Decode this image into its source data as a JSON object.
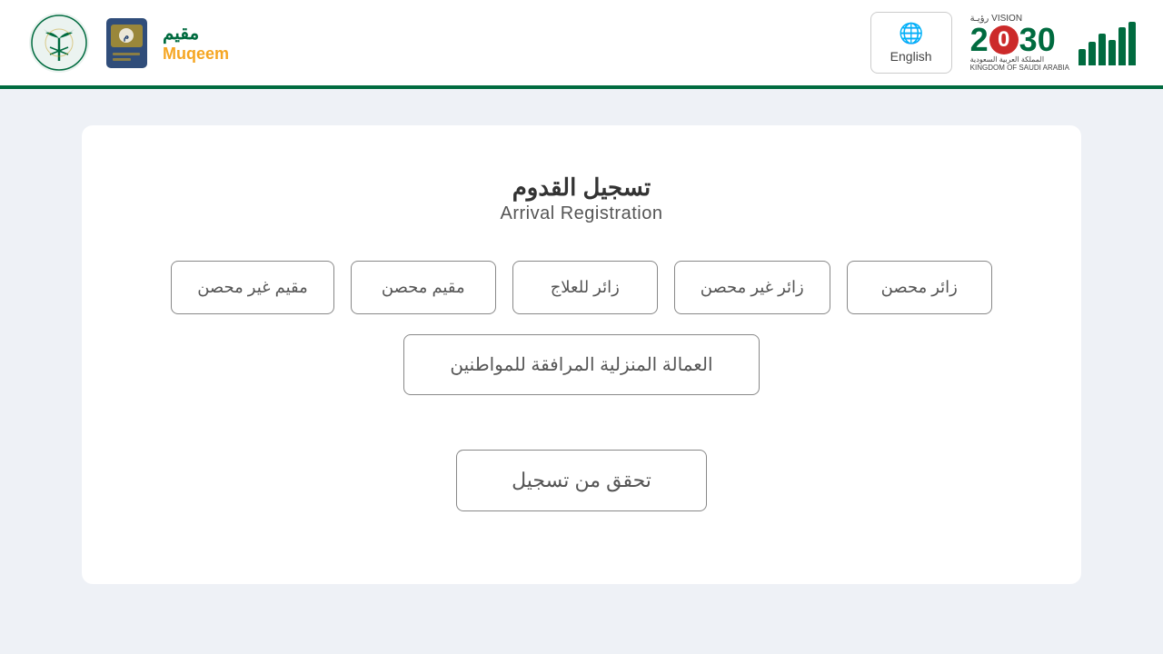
{
  "header": {
    "logo_muqeem_arabic": "مقيم",
    "logo_muqeem_english": "Muqeem",
    "english_button_label": "English",
    "vision_label_arabic": "رؤيــة",
    "vision_number": "2",
    "vision_ksa_arabic": "المملكة العربية السعودية",
    "vision_ksa_english": "KINGDOM OF SAUDI ARABIA",
    "vision_label_top": "VISION رؤيـة"
  },
  "page": {
    "title_arabic": "تسجيل القدوم",
    "title_english": "Arrival Registration"
  },
  "buttons": {
    "row1": [
      {
        "id": "vaccinated-visitor",
        "label": "زائر محصن"
      },
      {
        "id": "unvaccinated-visitor",
        "label": "زائر غير محصن"
      },
      {
        "id": "medical-visitor",
        "label": "زائر للعلاج"
      },
      {
        "id": "vaccinated-resident",
        "label": "مقيم محصن"
      },
      {
        "id": "unvaccinated-resident",
        "label": "مقيم غير محصن"
      }
    ],
    "row2": [
      {
        "id": "domestic-labor",
        "label": "العمالة المنزلية المرافقة للمواطنين"
      }
    ],
    "check": {
      "id": "check-registration",
      "label": "تحقق من تسجيل"
    }
  }
}
